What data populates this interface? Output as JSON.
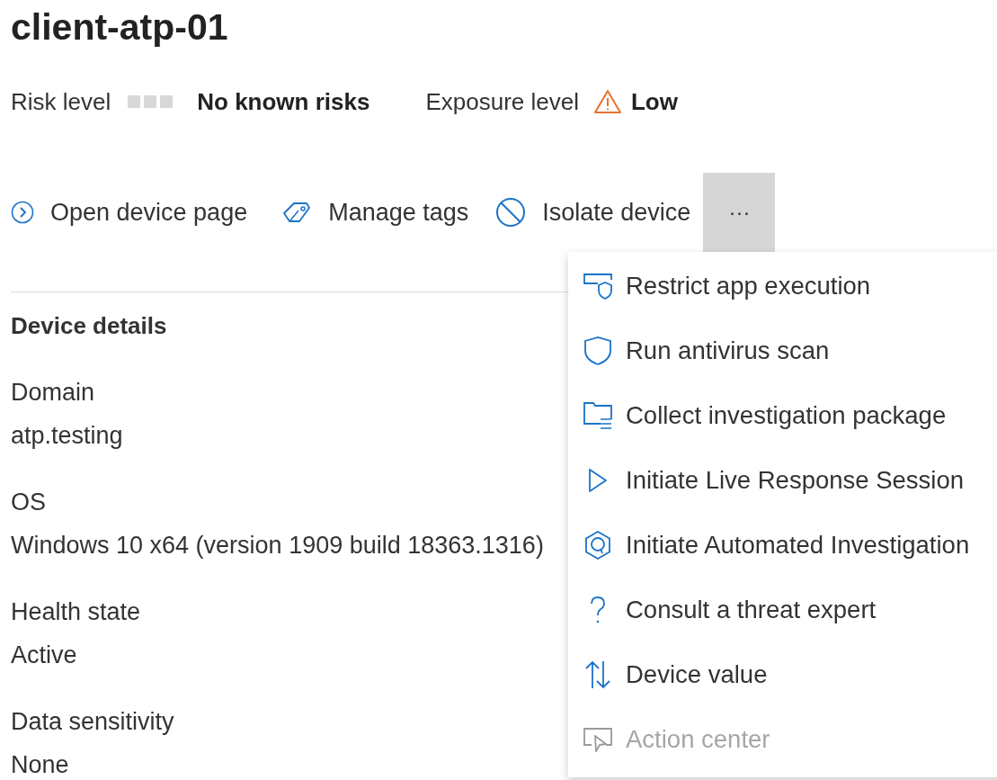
{
  "title": "client-atp-01",
  "risk": {
    "label": "Risk level",
    "value": "No known risks"
  },
  "exposure": {
    "label": "Exposure level",
    "value": "Low"
  },
  "actions": [
    {
      "label": "Open device page"
    },
    {
      "label": "Manage tags"
    },
    {
      "label": "Isolate device"
    }
  ],
  "more": {
    "label": "···",
    "expanded": true
  },
  "menu": [
    {
      "label": "Restrict app execution",
      "disabled": false
    },
    {
      "label": "Run antivirus scan",
      "disabled": false
    },
    {
      "label": "Collect investigation package",
      "disabled": false
    },
    {
      "label": "Initiate Live Response Session",
      "disabled": false
    },
    {
      "label": "Initiate Automated Investigation",
      "disabled": false
    },
    {
      "label": "Consult a threat expert",
      "disabled": false
    },
    {
      "label": "Device value",
      "disabled": false
    },
    {
      "label": "Action center",
      "disabled": true
    }
  ],
  "section_title": "Device details",
  "details": [
    {
      "label": "Domain",
      "value": "atp.testing"
    },
    {
      "label": "OS",
      "value": "Windows 10 x64 (version 1909 build 18363.1316)"
    },
    {
      "label": "Health state",
      "value": "Active"
    },
    {
      "label": "Data sensitivity",
      "value": "None"
    }
  ]
}
